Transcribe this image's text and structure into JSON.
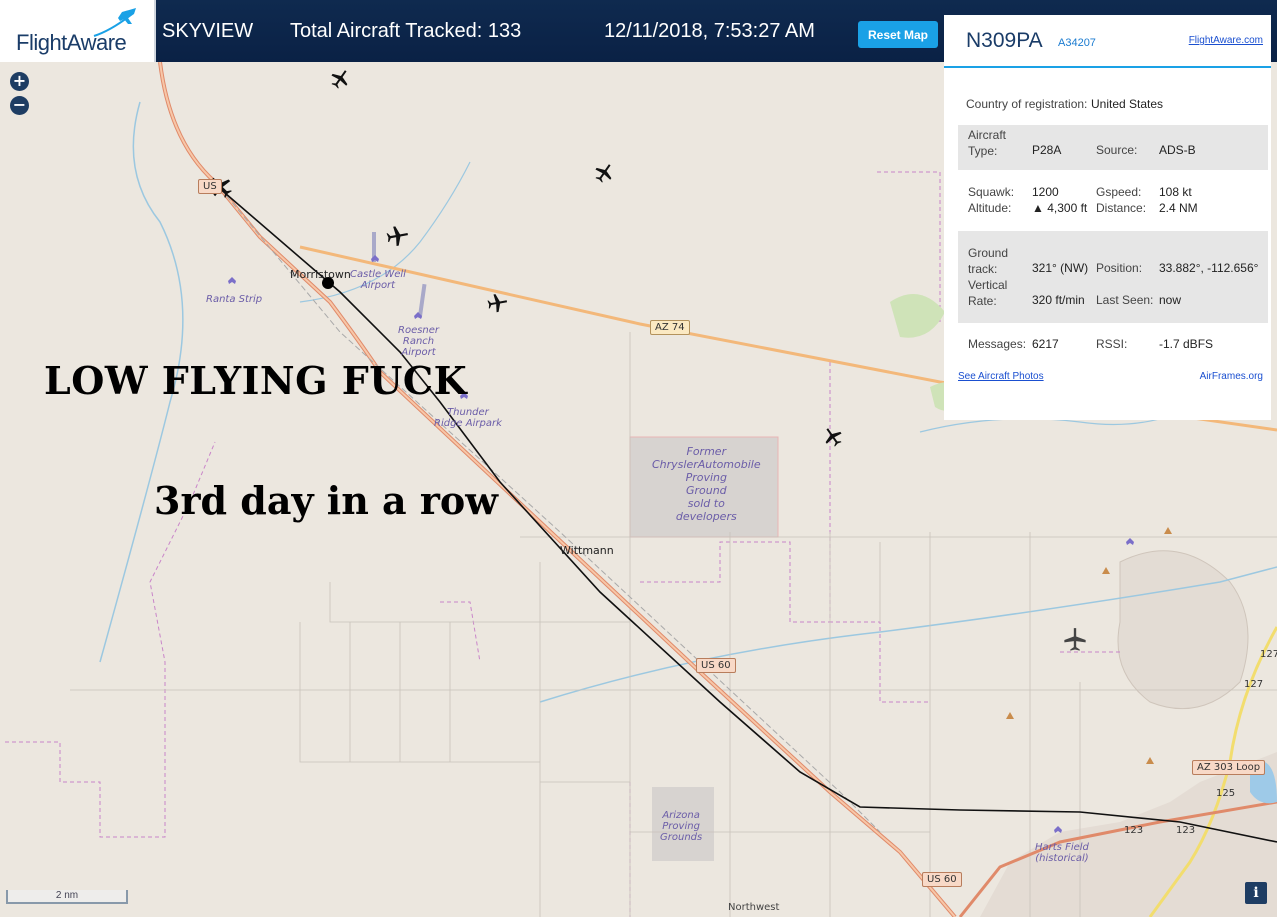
{
  "header": {
    "logo": "FlightAware",
    "app_name": "SKYVIEW",
    "tracked": "Total Aircraft Tracked: 133",
    "datetime": "12/11/2018, 7:53:27 AM",
    "reset_label": "Reset Map"
  },
  "map": {
    "zoom_in": "+",
    "zoom_out": "−",
    "overlay_main": "LOW FLYING FUCK",
    "overlay_sub": "3rd day in a row",
    "scale": "2 nm",
    "info": "i",
    "labels": {
      "morristown": "Morristown",
      "castle_well": "Castle Well\nAirport",
      "ranta": "Ranta Strip",
      "roesner": "Roesner\nRanch\nAirport",
      "thunder": "Thunder\nRidge Airpark",
      "chrysler": "Former\nChryslerAutomobile\nProving\nGround\nsold to\ndevelopers",
      "wittmann": "Wittmann",
      "arizona_pg": "Arizona\nProving\nGrounds",
      "harts": "Harts Field\n(historical)",
      "northwest": "Northwest"
    },
    "shields": {
      "us60_top": "US",
      "az74": "AZ 74",
      "us60_mid": "US 60",
      "us60_bot": "US 60",
      "az303": "AZ 303 Loop",
      "r127a": "127",
      "r127b": "127",
      "r125": "125",
      "r123a": "123",
      "r123b": "123"
    }
  },
  "panel": {
    "flight_id": "N309PA",
    "hex": "A34207",
    "fa_link": "FlightAware.com",
    "country_label": "Country of registration:",
    "country_value": "United States",
    "aircraft_type_label": "Aircraft\nType:",
    "aircraft_type": "P28A",
    "source_label": "Source:",
    "source": "ADS-B",
    "squawk_label": "Squawk:",
    "squawk": "1200",
    "gspeed_label": "Gspeed:",
    "gspeed": "108 kt",
    "altitude_label": "Altitude:",
    "altitude": "▲ 4,300 ft",
    "distance_label": "Distance:",
    "distance": "2.4 NM",
    "ground_track_label": "Ground\ntrack:",
    "ground_track": "321° (NW)",
    "position_label": "Position:",
    "position": "33.882°, -112.656°",
    "vertical_rate_label": "Vertical\nRate:",
    "vertical_rate": "320 ft/min",
    "last_seen_label": "Last Seen:",
    "last_seen": "now",
    "messages_label": "Messages:",
    "messages": "6217",
    "rssi_label": "RSSI:",
    "rssi": "-1.7 dBFS",
    "see_photos": "See Aircraft Photos",
    "airframes": "AirFrames.org"
  }
}
